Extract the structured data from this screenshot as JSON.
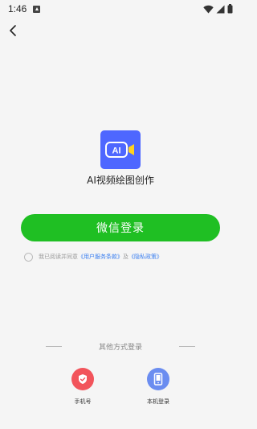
{
  "status_bar": {
    "time": "1:46",
    "icons": [
      "notification-icon",
      "wifi-icon",
      "signal-icon",
      "battery-icon"
    ]
  },
  "header": {
    "back_icon": "back-arrow-icon"
  },
  "app": {
    "name": "AI视频绘图创作",
    "logo_text": "AI"
  },
  "wechat_login": {
    "label": "微信登录"
  },
  "agreement": {
    "prefix": "我已阅读并同意",
    "terms_link": "《用户服务条款》",
    "conjunction": "及",
    "privacy_link": "《隐私政策》"
  },
  "other_login": {
    "title": "其他方式登录",
    "options": [
      {
        "label": "手机号",
        "icon": "phone-shield-icon",
        "color": "#f2545b"
      },
      {
        "label": "本机登录",
        "icon": "mobile-device-icon",
        "color": "#6b8df0"
      }
    ]
  }
}
